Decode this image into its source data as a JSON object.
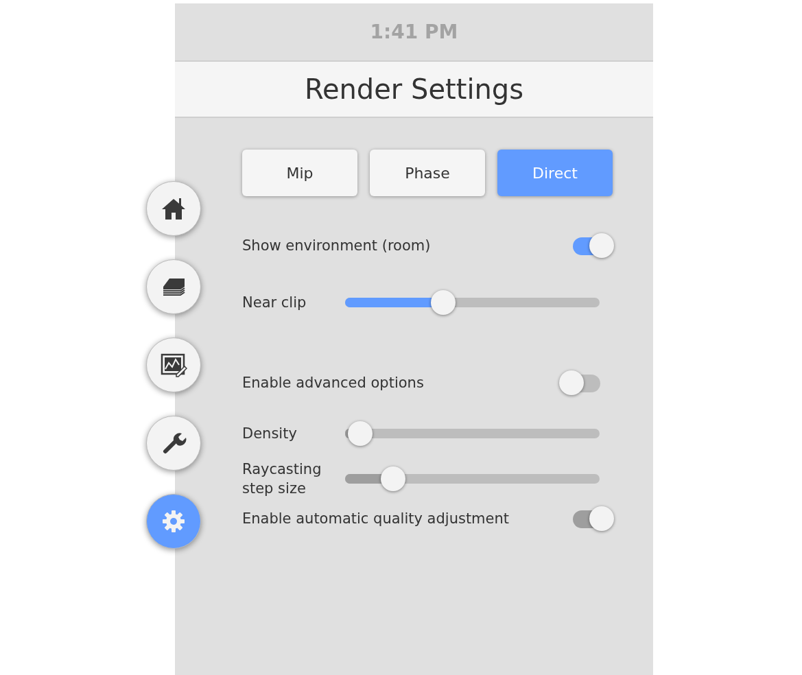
{
  "status_bar": {
    "time": "1:41 PM"
  },
  "title": "Render Settings",
  "nav": [
    {
      "selected": false
    },
    {
      "selected": false
    },
    {
      "selected": false
    },
    {
      "selected": false
    },
    {
      "selected": true
    }
  ],
  "modes": [
    {
      "label": "Mip",
      "selected": false
    },
    {
      "label": "Phase",
      "selected": false
    },
    {
      "label": "Direct",
      "selected": true
    }
  ],
  "controls": [
    {
      "kind": "toggle",
      "label": "Show environment (room)",
      "on": true,
      "disabled": false
    },
    {
      "kind": "slider",
      "label": "Near clip",
      "level": 0.385,
      "disabled": false
    },
    {
      "kind": "spacer"
    },
    {
      "kind": "toggle",
      "label": "Enable advanced options",
      "on": false,
      "disabled": false
    },
    {
      "kind": "slider",
      "label": "Density",
      "level": 0.06,
      "disabled": true
    },
    {
      "kind": "slider",
      "label": "Raycasting step size",
      "level": 0.19,
      "disabled": true
    },
    {
      "kind": "toggle",
      "label": "Enable automatic quality adjustment",
      "on": true,
      "disabled": true
    }
  ]
}
